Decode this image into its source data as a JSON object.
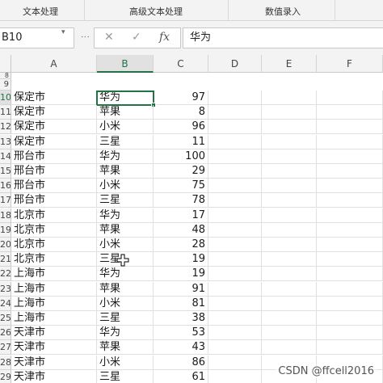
{
  "ribbon": {
    "groups": [
      "文本处理",
      "高级文本处理",
      "数值录入"
    ]
  },
  "formula_bar": {
    "name_box": "B10",
    "cancel_icon": "✕",
    "enter_icon": "✓",
    "fx_label": "fx",
    "formula_value": "华为"
  },
  "sheet": {
    "columns": [
      "A",
      "B",
      "C",
      "D",
      "E",
      "F"
    ],
    "active_column": "B",
    "partial_rows": [
      "8",
      "9"
    ],
    "rows": [
      {
        "num": "10",
        "a": "保定市",
        "b": "华为",
        "c": "97"
      },
      {
        "num": "11",
        "a": "保定市",
        "b": "苹果",
        "c": "8"
      },
      {
        "num": "12",
        "a": "保定市",
        "b": "小米",
        "c": "96"
      },
      {
        "num": "13",
        "a": "保定市",
        "b": "三星",
        "c": "11"
      },
      {
        "num": "14",
        "a": "邢台市",
        "b": "华为",
        "c": "100"
      },
      {
        "num": "15",
        "a": "邢台市",
        "b": "苹果",
        "c": "29"
      },
      {
        "num": "16",
        "a": "邢台市",
        "b": "小米",
        "c": "75"
      },
      {
        "num": "17",
        "a": "邢台市",
        "b": "三星",
        "c": "78"
      },
      {
        "num": "18",
        "a": "北京市",
        "b": "华为",
        "c": "17"
      },
      {
        "num": "19",
        "a": "北京市",
        "b": "苹果",
        "c": "48"
      },
      {
        "num": "20",
        "a": "北京市",
        "b": "小米",
        "c": "28"
      },
      {
        "num": "21",
        "a": "北京市",
        "b": "三星",
        "c": "19"
      },
      {
        "num": "22",
        "a": "上海市",
        "b": "华为",
        "c": "19"
      },
      {
        "num": "23",
        "a": "上海市",
        "b": "苹果",
        "c": "91"
      },
      {
        "num": "24",
        "a": "上海市",
        "b": "小米",
        "c": "81"
      },
      {
        "num": "25",
        "a": "上海市",
        "b": "三星",
        "c": "38"
      },
      {
        "num": "26",
        "a": "天津市",
        "b": "华为",
        "c": "53"
      },
      {
        "num": "27",
        "a": "天津市",
        "b": "苹果",
        "c": "43"
      },
      {
        "num": "28",
        "a": "天津市",
        "b": "小米",
        "c": "86"
      },
      {
        "num": "29",
        "a": "天津市",
        "b": "三星",
        "c": "61"
      }
    ]
  },
  "watermark": "CSDN @ffcell2016"
}
